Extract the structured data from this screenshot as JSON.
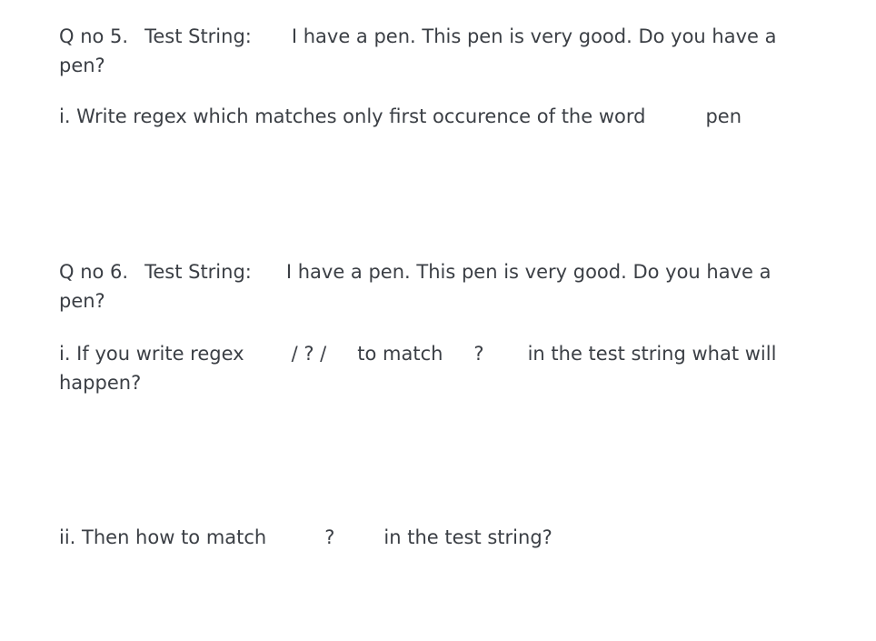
{
  "q5": {
    "number": "Q no 5.",
    "test_label": "Test String:",
    "test_string": "I have a pen. This pen is very good. Do you have a pen?",
    "part_i": {
      "prefix": "i. Write regex which matches only first occurence of the word",
      "word": "pen"
    }
  },
  "q6": {
    "number": "Q no 6.",
    "test_label": "Test String:",
    "test_string": "I have a pen. This pen is very good. Do you have a pen?",
    "part_i": {
      "prefix": "i. If you write regex",
      "regex": "/ ? /",
      "middle": "to match",
      "symbol": "?",
      "suffix": "in the test string what will happen?"
    },
    "part_ii": {
      "prefix": "ii. Then how to match",
      "symbol": "?",
      "suffix": "in the test string?"
    }
  }
}
